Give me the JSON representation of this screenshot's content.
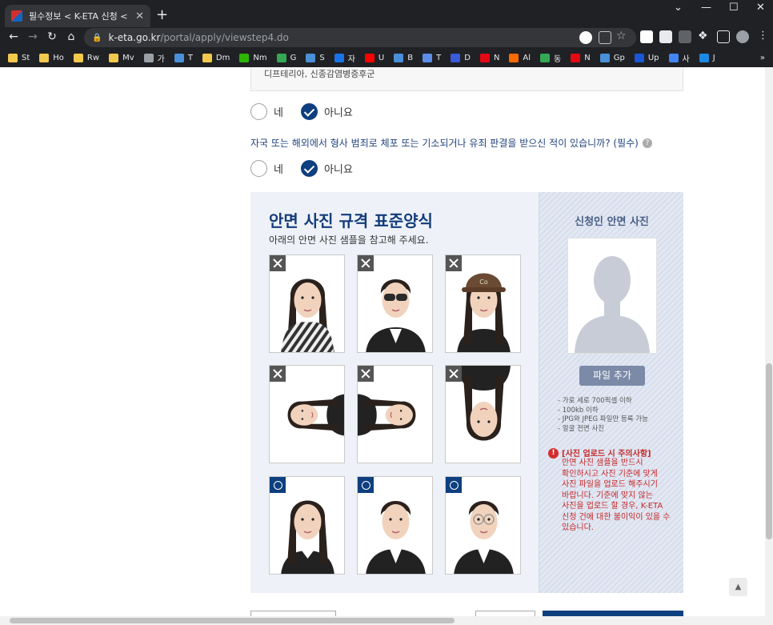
{
  "browser": {
    "tab_title": "필수정보 < K-ETA 신청 < K-ETA",
    "tab_close": "✕",
    "new_tab": "+",
    "window_controls": [
      "⌄",
      "—",
      "☐",
      "✕"
    ],
    "url_domain": "k-eta.go.kr",
    "url_path": "/portal/apply/viewstep4.do",
    "bookmarks": [
      {
        "label": "St",
        "color": "#f2c94c"
      },
      {
        "label": "Ho",
        "color": "#f2c94c"
      },
      {
        "label": "Rw",
        "color": "#f2c94c"
      },
      {
        "label": "Mv",
        "color": "#f2c94c"
      },
      {
        "label": "가",
        "color": "#9aa0a6"
      },
      {
        "label": "T",
        "color": "#4a90d9"
      },
      {
        "label": "Dm",
        "color": "#f2c94c"
      },
      {
        "label": "Nm",
        "color": "#2db400"
      },
      {
        "label": "G",
        "color": "#34a853"
      },
      {
        "label": "S",
        "color": "#4a90d9"
      },
      {
        "label": "자",
        "color": "#1a73e8"
      },
      {
        "label": "U",
        "color": "#ff0000"
      },
      {
        "label": "B",
        "color": "#4a90d9"
      },
      {
        "label": "T",
        "color": "#5c8de8"
      },
      {
        "label": "D",
        "color": "#3a5ad8"
      },
      {
        "label": "N",
        "color": "#e50914"
      },
      {
        "label": "Al",
        "color": "#ff6a00"
      },
      {
        "label": "동",
        "color": "#34a853"
      },
      {
        "label": "N",
        "color": "#e50914"
      },
      {
        "label": "Gp",
        "color": "#4a90d9"
      },
      {
        "label": "Up",
        "color": "#1a57d6"
      },
      {
        "label": "사",
        "color": "#4285f4"
      },
      {
        "label": "J",
        "color": "#1e88e5"
      }
    ],
    "bookmarks_more": "»"
  },
  "page": {
    "info_text": "디프테리아, 신종감염병증후군",
    "q1": {
      "yes": "네",
      "no": "아니요",
      "selected": "no"
    },
    "question2": "자국 또는 해외에서 형사 범죄로 체포 또는 기소되거나 유죄 판결을 받으신 적이 있습니까? (필수)",
    "question2_help": "?",
    "q2": {
      "yes": "네",
      "no": "아니요",
      "selected": "no"
    },
    "photo_standard": {
      "title": "안면 사진 규격 표준양식",
      "subtitle": "아래의 안면 사진 샘플을 참고해 주세요.",
      "samples": [
        {
          "verdict": "bad",
          "desc": "scarf covering face"
        },
        {
          "verdict": "bad",
          "desc": "sunglasses"
        },
        {
          "verdict": "bad",
          "desc": "cap"
        },
        {
          "verdict": "bad",
          "desc": "rotated left"
        },
        {
          "verdict": "bad",
          "desc": "rotated right"
        },
        {
          "verdict": "bad",
          "desc": "upside down"
        },
        {
          "verdict": "good",
          "desc": "woman front"
        },
        {
          "verdict": "good",
          "desc": "man front"
        },
        {
          "verdict": "good",
          "desc": "man glasses front"
        }
      ]
    },
    "applicant_photo": {
      "title": "신청인 안면 사진",
      "upload_button": "파일 추가",
      "rules": [
        "- 가로 세로 700픽셀 이하",
        "- 100kb 이하",
        "- JPG와 JPEG 파일만 등록 가능",
        "- 얼굴 전면 사진"
      ],
      "warning_title": "[사진 업로드 시 주의사항]",
      "warning_body": "안면 사진 샘플을 반드시 확인하시고 사진 기준에 맞게 사진 파일을 업로드 해주시기 바랍니다. 기준에 맞지 않는 사진을 업로드 할 경우, K-ETA 신청 건에 대한 불이익이 있을 수 있습니다."
    },
    "scroll_top": "▲"
  },
  "colors": {
    "primary": "#0e3f7e",
    "panel_bg": "#eef2f8",
    "warning": "#c62828"
  }
}
